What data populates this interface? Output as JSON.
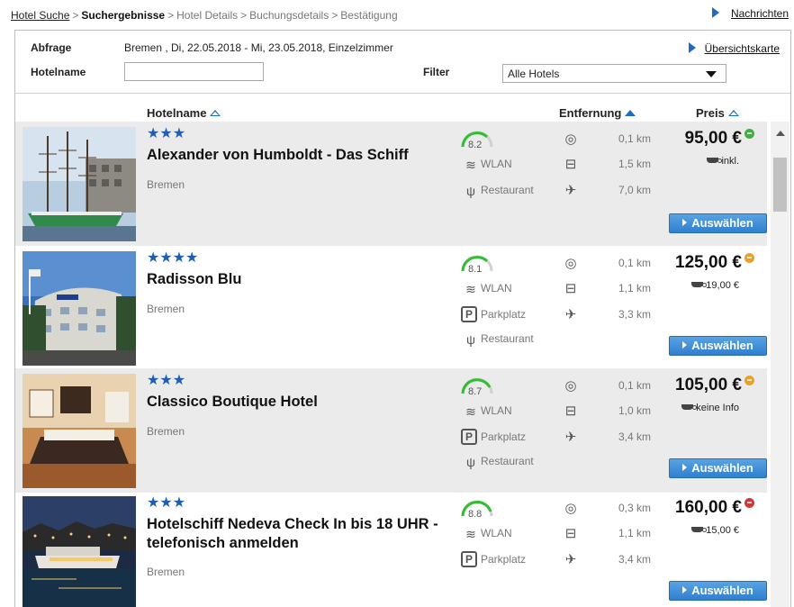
{
  "breadcrumb": {
    "items": [
      "Hotel Suche",
      "Suchergebnisse",
      "Hotel Details",
      "Buchungsdetails",
      "Bestätigung"
    ],
    "separator": ">"
  },
  "messages_link": "Nachrichten",
  "query": {
    "label": "Abfrage",
    "text": "Bremen , Di, 22.05.2018 - Mi, 23.05.2018, Einzelzimmer",
    "map_link": "Übersichtskarte",
    "hotelname_label": "Hotelname",
    "hotelname_value": "",
    "filter_label": "Filter",
    "filter_value": "Alle Hotels"
  },
  "columns": {
    "hotelname": "Hotelname",
    "distance": "Entfernung",
    "price": "Preis"
  },
  "select_label": "Auswählen",
  "colors": {
    "accent": "#1f6bc1",
    "stars": "#1f5fb0",
    "status_green": "#3cb33c",
    "status_orange": "#f0a020",
    "status_red": "#dd3333",
    "rating_arc": "#2fc02f"
  },
  "hotels": [
    {
      "stars": "★★★",
      "star_count": 3,
      "name": "Alexander von Humboldt - Das Schiff",
      "city": "Bremen",
      "rating": "8.2",
      "amenities": [
        {
          "icon": "wifi-icon",
          "label": "WLAN"
        },
        {
          "icon": "restaurant-icon",
          "label": "Restaurant"
        }
      ],
      "distances": [
        {
          "icon": "target-icon",
          "value": "0,1 km"
        },
        {
          "icon": "train-icon",
          "value": "1,5 km"
        },
        {
          "icon": "airplane-icon",
          "value": "7,0 km"
        }
      ],
      "price": "95,00 €",
      "status": "green",
      "breakfast": "inkl."
    },
    {
      "stars": "★★★★",
      "star_count": 4,
      "name": "Radisson Blu",
      "city": "Bremen",
      "rating": "8.1",
      "amenities": [
        {
          "icon": "wifi-icon",
          "label": "WLAN"
        },
        {
          "icon": "parking-icon",
          "label": "Parkplatz"
        },
        {
          "icon": "restaurant-icon",
          "label": "Restaurant"
        }
      ],
      "distances": [
        {
          "icon": "target-icon",
          "value": "0,1 km"
        },
        {
          "icon": "train-icon",
          "value": "1,1 km"
        },
        {
          "icon": "airplane-icon",
          "value": "3,3 km"
        }
      ],
      "price": "125,00 €",
      "status": "orange",
      "breakfast": "19,00 €"
    },
    {
      "stars": "★★★",
      "star_count": 3,
      "name": "Classico Boutique Hotel",
      "city": "Bremen",
      "rating": "8.7",
      "amenities": [
        {
          "icon": "wifi-icon",
          "label": "WLAN"
        },
        {
          "icon": "parking-icon",
          "label": "Parkplatz"
        },
        {
          "icon": "restaurant-icon",
          "label": "Restaurant"
        }
      ],
      "distances": [
        {
          "icon": "target-icon",
          "value": "0,1 km"
        },
        {
          "icon": "train-icon",
          "value": "1,0 km"
        },
        {
          "icon": "airplane-icon",
          "value": "3,4 km"
        }
      ],
      "price": "105,00 €",
      "status": "orange",
      "breakfast": "keine Info"
    },
    {
      "stars": "★★★",
      "star_count": 3,
      "name": "Hotelschiff Nedeva Check In bis 18 UHR - telefonisch anmelden",
      "city": "Bremen",
      "rating": "8.8",
      "amenities": [
        {
          "icon": "wifi-icon",
          "label": "WLAN"
        },
        {
          "icon": "parking-icon",
          "label": "Parkplatz"
        }
      ],
      "distances": [
        {
          "icon": "target-icon",
          "value": "0,3 km"
        },
        {
          "icon": "train-icon",
          "value": "1,1 km"
        },
        {
          "icon": "airplane-icon",
          "value": "3,4 km"
        }
      ],
      "price": "160,00 €",
      "status": "red",
      "breakfast": "15,00 €"
    }
  ]
}
